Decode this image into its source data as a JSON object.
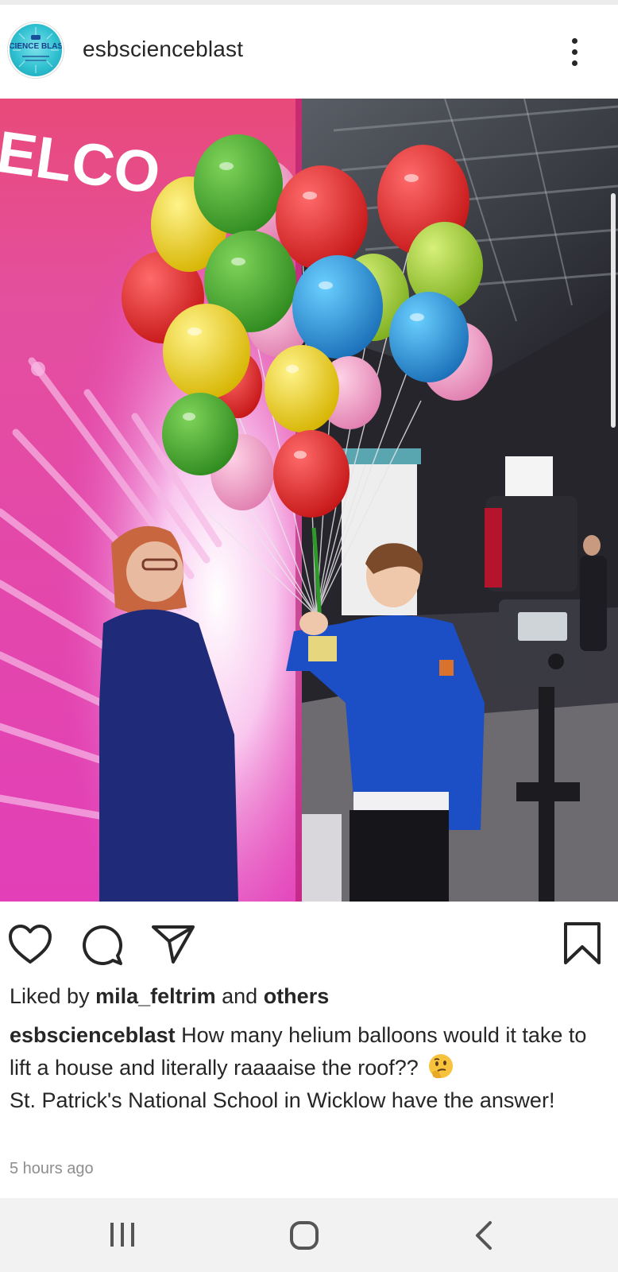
{
  "post": {
    "username": "esbscienceblast",
    "avatar_label": "SCIENCE BLAST",
    "image_sign_text": "ELCO",
    "liked_prefix": "Liked by ",
    "liked_user": "mila_feltrim",
    "liked_mid": " and ",
    "liked_others": "others",
    "caption_user": "esbscienceblast",
    "caption_text": " How many helium balloons would it take to lift a house and literally raaaaise the roof?? ",
    "caption_text_2": "St. Patrick's National School in Wicklow have the answer!",
    "caption_emoji": "thinking-face-emoji",
    "time_ago": "5 hours ago"
  },
  "icons": {
    "like": "heart-icon",
    "comment": "comment-icon",
    "share": "share-icon",
    "save": "bookmark-icon",
    "more": "more-vertical-icon"
  },
  "nav": {
    "recents": "recents-icon",
    "home": "home-icon",
    "back": "back-icon"
  },
  "colors": {
    "text": "#262626",
    "muted": "#8e8e8e",
    "navbar": "#f2f2f2",
    "avatar": "#2fc0d0"
  }
}
